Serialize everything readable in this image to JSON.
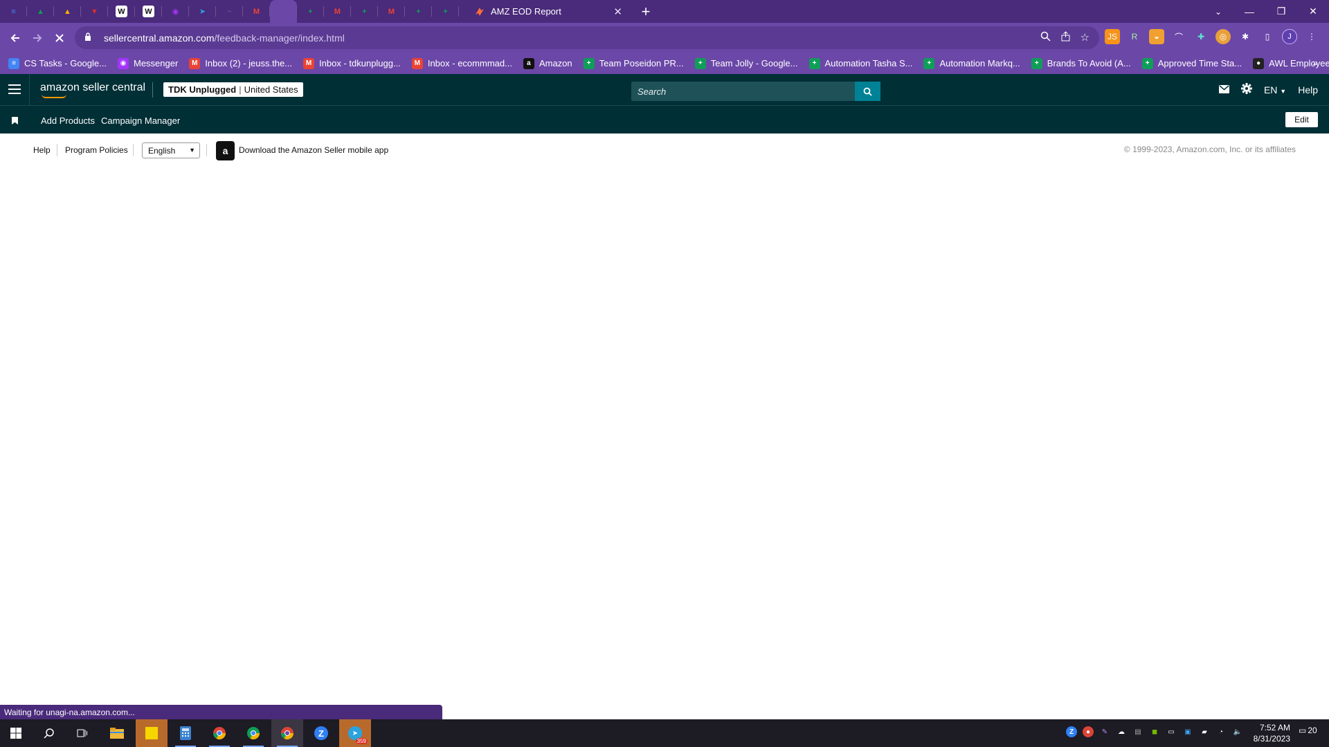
{
  "browser": {
    "active_tab_title": "AMZ EOD Report",
    "url_host": "sellercentral.amazon.com",
    "url_path": "/feedback-manager/index.html",
    "pinned_tabs": [
      {
        "icon": "docs-icon",
        "color": "#4285f4",
        "glyph": "≡"
      },
      {
        "icon": "drive-icon",
        "color": "#0f9d58",
        "glyph": "▲"
      },
      {
        "icon": "drive-icon",
        "color": "#f4b400",
        "glyph": "▲"
      },
      {
        "icon": "reddit-like-icon",
        "color": "#d93025",
        "glyph": "▼"
      },
      {
        "icon": "wk-icon",
        "color": "#ffffff",
        "glyph": "W"
      },
      {
        "icon": "wk-icon",
        "color": "#ffffff",
        "glyph": "W"
      },
      {
        "icon": "messenger-icon",
        "color": "#a334fa",
        "glyph": "◉"
      },
      {
        "icon": "telegram-icon",
        "color": "#2aa3df",
        "glyph": "➤"
      },
      {
        "icon": "signature-icon",
        "color": "#6b47a8",
        "glyph": "~"
      },
      {
        "icon": "gmail-icon",
        "color": "#ea4335",
        "glyph": "M"
      },
      {
        "icon": "loading-icon",
        "color": "#6b47a8",
        "glyph": "("
      },
      {
        "icon": "sheets-icon",
        "color": "#0f9d58",
        "glyph": "+"
      },
      {
        "icon": "gmail-icon",
        "color": "#ea4335",
        "glyph": "M"
      },
      {
        "icon": "sheets-icon",
        "color": "#0f9d58",
        "glyph": "+"
      },
      {
        "icon": "gmail-icon",
        "color": "#ea4335",
        "glyph": "M"
      },
      {
        "icon": "sheets-icon",
        "color": "#0f9d58",
        "glyph": "+"
      },
      {
        "icon": "sheets-icon",
        "color": "#0f9d58",
        "glyph": "+"
      }
    ],
    "bookmarks": [
      {
        "label": "CS Tasks - Google...",
        "icon": "docs-icon",
        "color": "#4285f4",
        "glyph": "≡"
      },
      {
        "label": "Messenger",
        "icon": "messenger-icon",
        "color": "#a334fa",
        "glyph": "◉"
      },
      {
        "label": "Inbox (2) - jeuss.the...",
        "icon": "gmail-icon",
        "color": "#ea4335",
        "glyph": "M"
      },
      {
        "label": "Inbox - tdkunplugg...",
        "icon": "gmail-icon",
        "color": "#ea4335",
        "glyph": "M"
      },
      {
        "label": "Inbox - ecommmad...",
        "icon": "gmail-icon",
        "color": "#ea4335",
        "glyph": "M"
      },
      {
        "label": "Amazon",
        "icon": "amazon-icon",
        "color": "#111111",
        "glyph": "a"
      },
      {
        "label": "Team Poseidon PR...",
        "icon": "sheets-icon",
        "color": "#0f9d58",
        "glyph": "+"
      },
      {
        "label": "Team Jolly - Google...",
        "icon": "sheets-icon",
        "color": "#0f9d58",
        "glyph": "+"
      },
      {
        "label": "Automation Tasha S...",
        "icon": "sheets-icon",
        "color": "#0f9d58",
        "glyph": "+"
      },
      {
        "label": "Automation Markq...",
        "icon": "sheets-icon",
        "color": "#0f9d58",
        "glyph": "+"
      },
      {
        "label": "Brands To Avoid (A...",
        "icon": "sheets-icon",
        "color": "#0f9d58",
        "glyph": "+"
      },
      {
        "label": "Approved Time Sta...",
        "icon": "sheets-icon",
        "color": "#0f9d58",
        "glyph": "+"
      },
      {
        "label": "AWL Employee Portal",
        "icon": "awl-icon",
        "color": "#222222",
        "glyph": "●"
      }
    ],
    "profile_initial": "J",
    "status_text": "Waiting for unagi-na.amazon.com..."
  },
  "seller_central": {
    "logo_text": "amazon seller central",
    "account_name": "TDK Unplugged",
    "marketplace": "United States",
    "search_placeholder": "Search",
    "language": "EN",
    "help_label": "Help",
    "nav_links": [
      "Add Products",
      "Campaign Manager"
    ],
    "edit_label": "Edit"
  },
  "footer": {
    "help": "Help",
    "program_policies": "Program Policies",
    "language_selected": "English",
    "app_link": "Download the Amazon Seller mobile app",
    "copyright": "© 1999-2023, Amazon.com, Inc. or its affiliates"
  },
  "taskbar": {
    "time": "7:52 AM",
    "date": "8/31/2023",
    "notification_count": "20",
    "telegram_badge": "359"
  }
}
